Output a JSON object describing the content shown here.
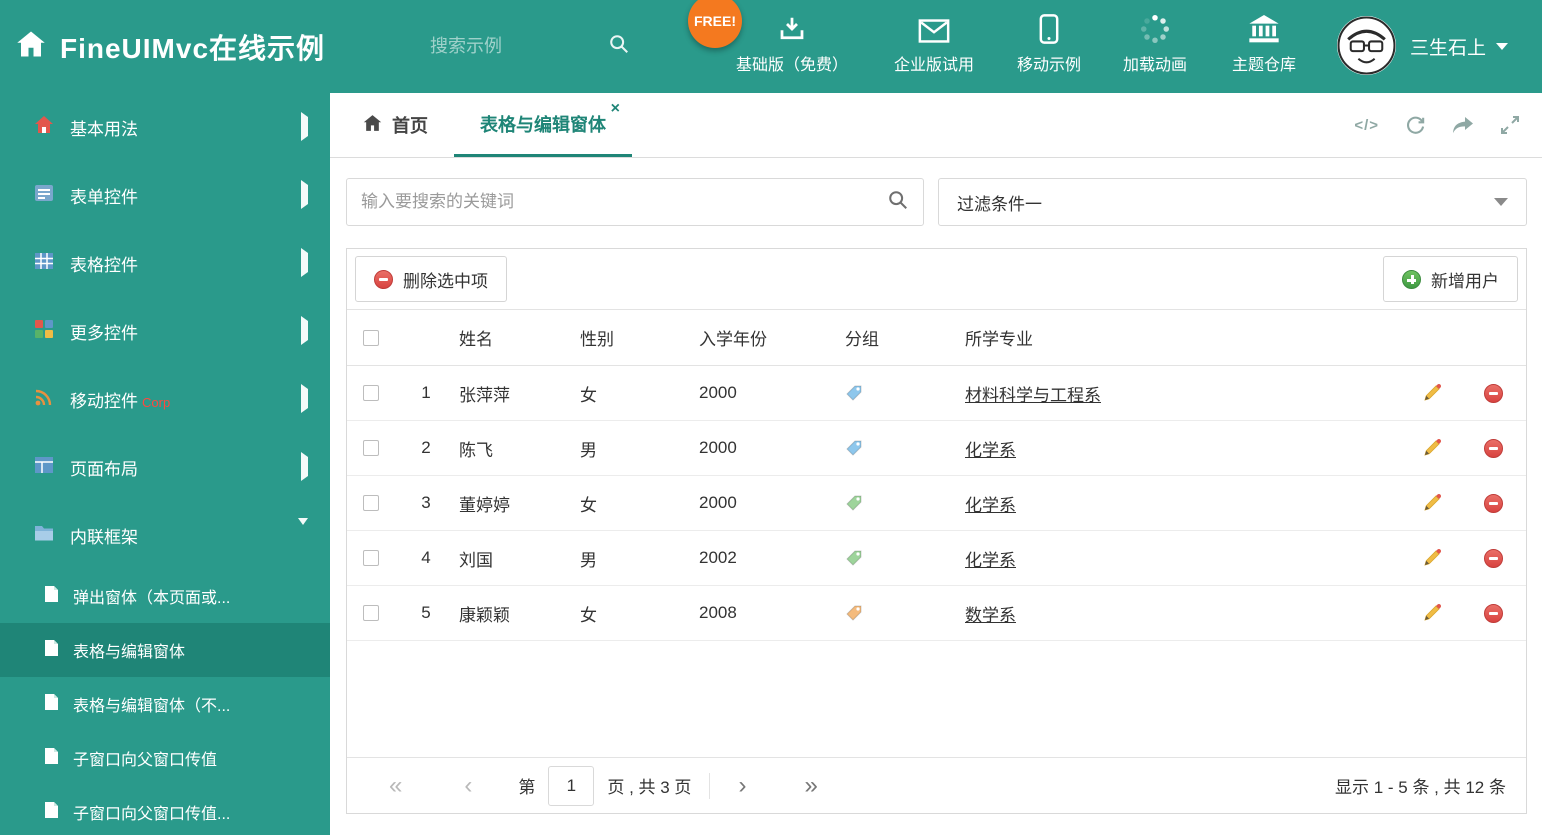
{
  "colors": {
    "theme": "#2a9a8b",
    "theme_dark": "#1f8577",
    "badge_orange": "#f4791f",
    "delete_red": "#d84340",
    "add_green": "#3f9a43",
    "pencil_yellow": "#f0bc45"
  },
  "header": {
    "title": "FineUIMvc在线示例",
    "search_placeholder": "搜索示例",
    "free_badge": "FREE!",
    "nav": [
      {
        "label": "基础版（免费）"
      },
      {
        "label": "企业版试用"
      },
      {
        "label": "移动示例"
      },
      {
        "label": "加载动画"
      },
      {
        "label": "主题仓库"
      }
    ],
    "user_name": "三生石上"
  },
  "sidebar": {
    "items": [
      {
        "label": "基本用法"
      },
      {
        "label": "表单控件"
      },
      {
        "label": "表格控件"
      },
      {
        "label": "更多控件"
      },
      {
        "label": "移动控件",
        "badge": "Corp"
      },
      {
        "label": "页面布局"
      },
      {
        "label": "内联框架"
      }
    ],
    "subitems": [
      {
        "label": "弹出窗体（本页面或..."
      },
      {
        "label": "表格与编辑窗体"
      },
      {
        "label": "表格与编辑窗体（不..."
      },
      {
        "label": "子窗口向父窗口传值"
      },
      {
        "label": "子窗口向父窗口传值..."
      }
    ]
  },
  "tabs": {
    "home_label": "首页",
    "active_label": "表格与编辑窗体",
    "close_glyph": "×",
    "code_icon_glyph": "</>"
  },
  "filter": {
    "search_placeholder": "输入要搜索的关键词",
    "dropdown_value": "过滤条件一"
  },
  "toolbar": {
    "delete_label": "删除选中项",
    "add_label": "新增用户"
  },
  "table": {
    "columns": {
      "name": "姓名",
      "gender": "性别",
      "year": "入学年份",
      "group": "分组",
      "major": "所学专业"
    },
    "rows": [
      {
        "num": "1",
        "name": "张萍萍",
        "gender": "女",
        "year": "2000",
        "tag_color": "#8ec7ec",
        "major": "材料科学与工程系"
      },
      {
        "num": "2",
        "name": "陈飞",
        "gender": "男",
        "year": "2000",
        "tag_color": "#8ec7ec",
        "major": "化学系"
      },
      {
        "num": "3",
        "name": "董婷婷",
        "gender": "女",
        "year": "2000",
        "tag_color": "#9ed49b",
        "major": "化学系"
      },
      {
        "num": "4",
        "name": "刘国",
        "gender": "男",
        "year": "2002",
        "tag_color": "#9ed49b",
        "major": "化学系"
      },
      {
        "num": "5",
        "name": "康颖颖",
        "gender": "女",
        "year": "2008",
        "tag_color": "#f4bb7d",
        "major": "数学系"
      }
    ]
  },
  "pagination": {
    "first_glyph": "«",
    "prev_glyph": "‹",
    "next_glyph": "›",
    "last_glyph": "»",
    "page_prefix": "第",
    "page_value": "1",
    "page_suffix": "页 , 共 3 页",
    "summary": "显示 1 - 5 条 , 共 12 条"
  }
}
